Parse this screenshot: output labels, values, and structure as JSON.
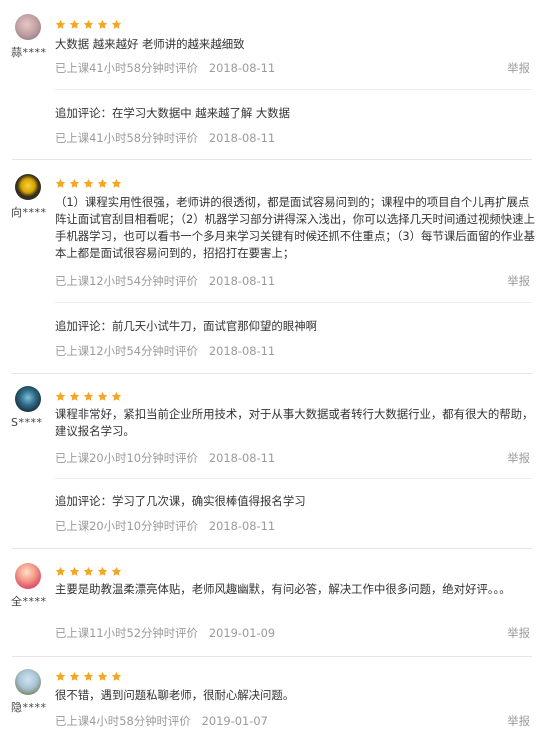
{
  "reviews": [
    {
      "user": "蒜****",
      "text": "大数据 越来越好 老师讲的越来越细致",
      "meta_time": "已上课41小时58分钟时评价",
      "date": "2018-08-11",
      "report": "举报",
      "followup_text": "追加评论：在学习大数据中 越来越了解 大数据",
      "followup_time": "已上课41小时58分钟时评价",
      "followup_date": "2018-08-11"
    },
    {
      "user": "向****",
      "text": "（1）课程实用性很强，老师讲的很透彻，都是面试容易问到的；课程中的项目自个儿再扩展点阵让面试官刮目相看呢；（2）机器学习部分讲得深入浅出，你可以选择几天时间通过视频快速上手机器学习，也可以看书一个多月来学习关键有时候还抓不住重点；（3）每节课后面留的作业基本上都是面试很容易问到的，招招打在要害上；",
      "meta_time": "已上课12小时54分钟时评价",
      "date": "2018-08-11",
      "report": "举报",
      "followup_text": "追加评论：前几天小试牛刀，面试官那仰望的眼神啊",
      "followup_time": "已上课12小时54分钟时评价",
      "followup_date": "2018-08-11"
    },
    {
      "user": "S****",
      "text": "课程非常好，紧扣当前企业所用技术，对于从事大数据或者转行大数据行业，都有很大的帮助，建议报名学习。",
      "meta_time": "已上课20小时10分钟时评价",
      "date": "2018-08-11",
      "report": "举报",
      "followup_text": "追加评论：学习了几次课，确实很棒值得报名学习",
      "followup_time": "已上课20小时10分钟时评价",
      "followup_date": "2018-08-11"
    },
    {
      "user": "全****",
      "text": "主要是助教温柔漂亮体贴，老师风趣幽默，有问必答，解决工作中很多问题，绝对好评。。。",
      "meta_time": "已上课11小时52分钟时评价",
      "date": "2019-01-09",
      "report": "举报"
    },
    {
      "user": "隐****",
      "text": "很不错，遇到问题私聊老师，很耐心解决问题。",
      "meta_time": "已上课4小时58分钟时评价",
      "date": "2019-01-07",
      "report": "举报"
    }
  ],
  "rating_stars": 5,
  "colors": {
    "star": "#f5a623",
    "meta": "#9b9b9b",
    "text": "#333333"
  }
}
